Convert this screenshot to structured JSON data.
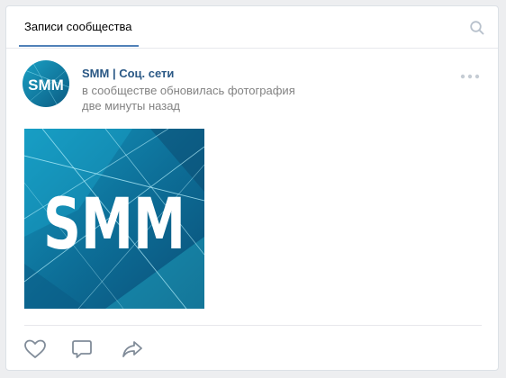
{
  "tabs": {
    "active_label": "Записи сообщества"
  },
  "post": {
    "author": "SMM | Соц. сети",
    "action": "в сообществе обновилась фотография",
    "time": "две минуты назад",
    "avatar_text": "SMM",
    "image_text": "SMM"
  },
  "icons": {
    "search": "search-icon",
    "more": "more-dots-icon",
    "like": "heart-icon",
    "comment": "comment-icon",
    "share": "share-icon"
  },
  "colors": {
    "accent": "#5181b8",
    "link": "#2a5885",
    "secondary_text": "#828282",
    "icon": "#818c99"
  }
}
